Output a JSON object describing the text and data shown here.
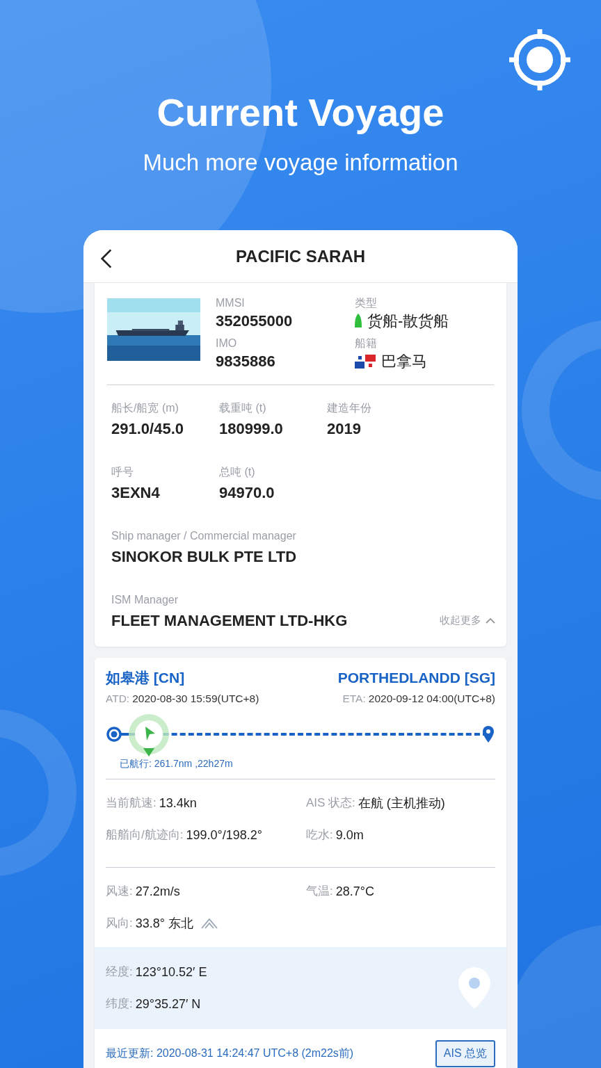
{
  "header": {
    "title": "Current Voyage",
    "subtitle": "Much more voyage information"
  },
  "nav": {
    "title": "PACIFIC SARAH"
  },
  "ship": {
    "ids": [
      {
        "label": "MMSI",
        "value": "352055000",
        "kind": "plain"
      },
      {
        "label": "类型",
        "value": "货船-散货船",
        "kind": "type"
      },
      {
        "label": "IMO",
        "value": "9835886",
        "kind": "plain"
      },
      {
        "label": "船籍",
        "value": "巴拿马",
        "kind": "flag"
      }
    ],
    "specs": [
      {
        "label": "船长/船宽 (m)",
        "value": "291.0/45.0"
      },
      {
        "label": "载重吨 (t)",
        "value": "180999.0"
      },
      {
        "label": "建造年份",
        "value": "2019"
      },
      {
        "label": "呼号",
        "value": "3EXN4"
      },
      {
        "label": "总吨 (t)",
        "value": "94970.0"
      }
    ],
    "managers": [
      {
        "label": "Ship manager / Commercial manager",
        "value": "SINOKOR BULK PTE LTD"
      },
      {
        "label": "ISM Manager",
        "value": "FLEET MANAGEMENT LTD-HKG"
      }
    ],
    "collapse": "收起更多",
    "expanded": true
  },
  "voyage": {
    "from": "如皋港 [CN]",
    "to": "PORTHEDLANDD [SG]",
    "departure": {
      "label": "ATD:",
      "value": "2020-08-30 15:59(UTC+8)"
    },
    "arrival": {
      "label": "ETA:",
      "value": "2020-09-12 04:00(UTC+8)"
    },
    "level": 0.09,
    "sailed": "已航行: 261.7nm ,22h27m"
  },
  "status": [
    {
      "label": "当前航速:",
      "value": "13.4kn"
    },
    {
      "label": "AIS 状态:",
      "value": "在航 (主机推动)"
    },
    {
      "label": "船艏向/航迹向:",
      "value": "199.0°/198.2°"
    },
    {
      "label": "吃水:",
      "value": "9.0m"
    }
  ],
  "weather": [
    {
      "label": "风速:",
      "value": "27.2m/s"
    },
    {
      "label": "气温:",
      "value": "28.7°C"
    },
    {
      "label": "风向:",
      "value": "33.8° 东北",
      "kind": "wind"
    }
  ],
  "position": [
    {
      "label": "经度:",
      "value": "123°10.52′ E"
    },
    {
      "label": "纬度:",
      "value": "29°35.27′ N"
    }
  ],
  "update": "最近更新: 2020-08-31 14:24:47 UTC+8 (2m22s前)",
  "ais_button": "AIS 总览"
}
